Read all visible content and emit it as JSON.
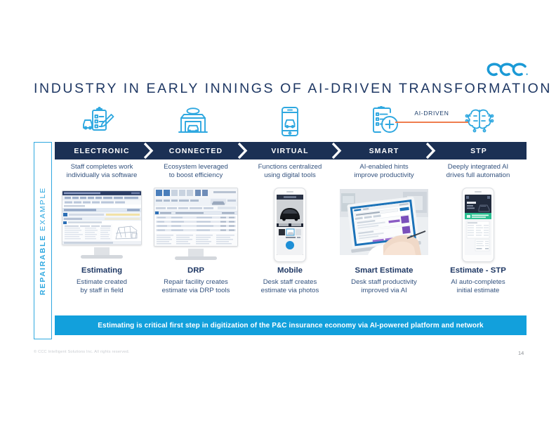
{
  "brand": {
    "logo_name": "ccc-logo",
    "logo_color": "#1b9ad6",
    "navy": "#1f3864",
    "bar_navy": "#1b3054",
    "cyan": "#2fa8e0",
    "banner_blue": "#12a0dc",
    "orange": "#ef7d4e"
  },
  "title": "INDUSTRY IN EARLY INNINGS OF AI-DRIVEN TRANSFORMATION",
  "ai_driven": {
    "label": "AI-DRIVEN"
  },
  "side_label": {
    "bold": "REPAIRABLE",
    "light": " EXAMPLE"
  },
  "stages": [
    {
      "name": "ELECTRONIC",
      "icon": "clipboard-pen-car-icon",
      "description": "Staff completes work\nindividually via software",
      "desc_line1": "Staff completes work",
      "desc_line2": "individually via software",
      "visual": "desktop-monitor-estimating-software",
      "title": "Estimating",
      "cap_line1": "Estimate created",
      "cap_line2": "by staff in field"
    },
    {
      "name": "CONNECTED",
      "icon": "repair-shop-building-icon",
      "desc_line1": "Ecosystem leveraged",
      "desc_line2": "to boost efficiency",
      "visual": "desktop-monitor-drp-software",
      "title": "DRP",
      "cap_line1": "Repair facility creates",
      "cap_line2": "estimate via DRP tools"
    },
    {
      "name": "VIRTUAL",
      "icon": "smartphone-car-icon",
      "desc_line1": "Functions centralized",
      "desc_line2": "using digital tools",
      "visual": "smartphone-photo-capture",
      "title": "Mobile",
      "cap_line1": "Desk staff creates",
      "cap_line2": "estimate via photos"
    },
    {
      "name": "SMART",
      "icon": "clipboard-plus-icon",
      "desc_line1": "AI-enabled hints",
      "desc_line2": "improve productivity",
      "visual": "laptop-hands-typing-photo",
      "title": "Smart Estimate",
      "cap_line1": "Desk staff productivity",
      "cap_line2": "improved via AI"
    },
    {
      "name": "STP",
      "icon": "ai-chip-brain-icon",
      "desc_line1": "Deeply integrated AI",
      "desc_line2": "drives full automation",
      "visual": "smartphone-auto-estimate",
      "title": "Estimate - STP",
      "cap_line1": "AI auto-completes",
      "cap_line2": "initial estimate"
    }
  ],
  "banner": "Estimating is critical first step in digitization of the P&C insurance economy via AI-powered platform and network",
  "footer": {
    "copyright": "© CCC Intelligent Solutions Inc. All rights reserved.",
    "page_number": "14"
  }
}
